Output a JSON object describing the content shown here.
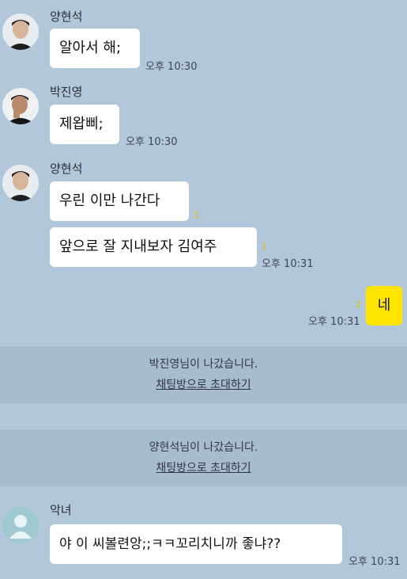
{
  "messages": [
    {
      "sender": "양현석",
      "text": "알아서 해;",
      "time": "오후 10:30"
    },
    {
      "sender": "박진영",
      "text": "제왑삐;",
      "time": "오후 10:30"
    },
    {
      "sender": "양현석",
      "text": "우린 이만 나간다",
      "unread": "1"
    },
    {
      "text": "앞으로 잘 지내보자 김여주",
      "unread": "1",
      "time": "오후 10:31"
    },
    {
      "text": "네",
      "unread": "2",
      "time": "오후 10:31"
    },
    {
      "sender": "악녀",
      "text": "야 이 씨볼련앙;;ㅋㅋ꼬리치니까 좋냐??",
      "time": "오후 10:31"
    }
  ],
  "notices": [
    {
      "name": "박진영",
      "suffix": "님이 나갔습니다.",
      "invite": "채팅방으로 초대하기"
    },
    {
      "name": "양현석",
      "suffix": "님이 나갔습니다.",
      "invite": "채팅방으로 초대하기"
    }
  ],
  "colors": {
    "background": "#b2c7da",
    "my_bubble": "#fee500",
    "other_bubble": "#ffffff"
  },
  "icons": [
    "profile-photo",
    "default-profile-icon"
  ]
}
